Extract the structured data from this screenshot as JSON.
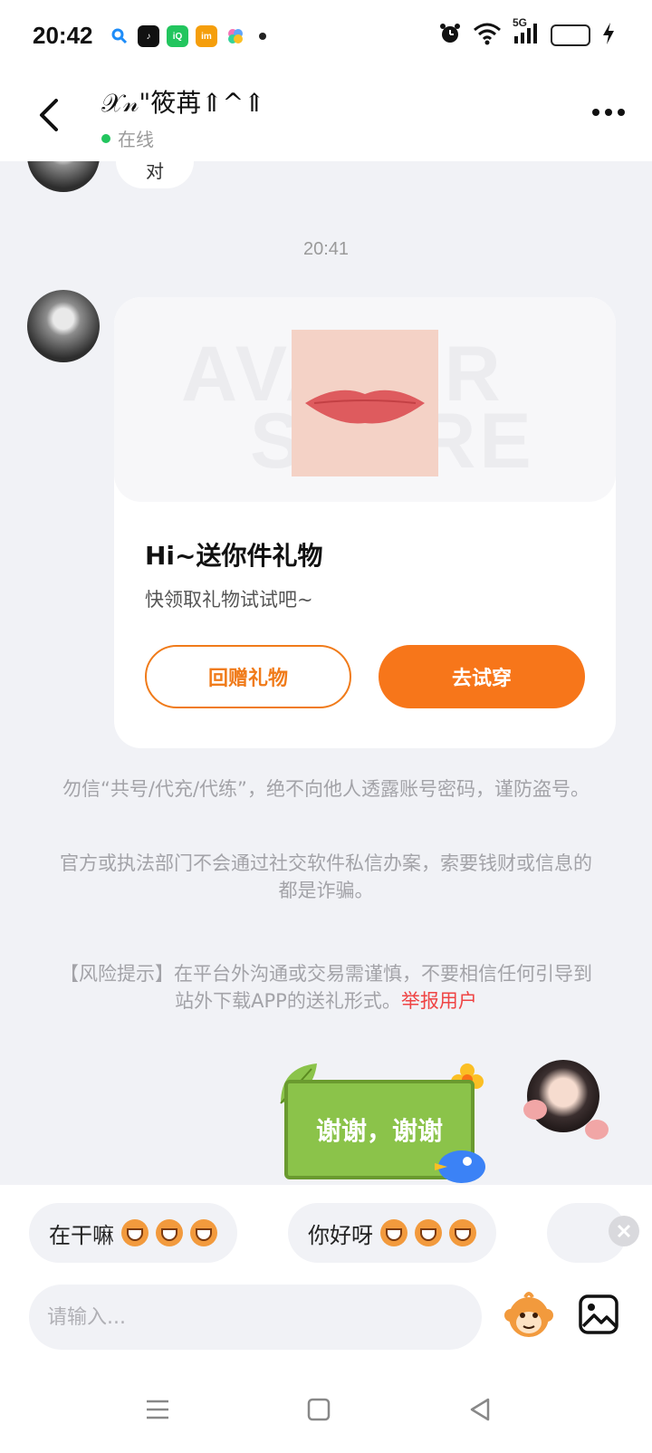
{
  "status_bar": {
    "time": "20:42",
    "app_icons": [
      "search-icon",
      "tiktok-icon",
      "iqiyi-icon",
      "imou-icon",
      "flower-app-icon"
    ],
    "network_label": "5G",
    "battery_level": "5",
    "icons": [
      "alarm-icon",
      "wifi-icon",
      "signal-icon",
      "battery-icon",
      "charging-icon"
    ]
  },
  "header": {
    "contact_name": "𝒳𝓃\"筱苒⇑^⇑",
    "status_text": "在线",
    "status_color": "#22c55e"
  },
  "chat": {
    "partial_message": "对",
    "timestamp": "20:41",
    "gift_card": {
      "watermark_top": "AVATAR",
      "watermark_bottom": "STORE",
      "title": "Hi~送你件礼物",
      "subtitle": "快领取礼物试试吧~",
      "return_gift_label": "回赠礼物",
      "try_on_label": "去试穿",
      "accent_color": "#f7761a"
    },
    "notices": [
      "勿信“共号/代充/代练”，绝不向他人透露账号密码，谨防盗号。",
      "官方或执法部门不会通过社交软件私信办案，索要钱财或信息的都是诈骗。"
    ],
    "risk_notice": {
      "text": "【风险提示】在平台外沟通或交易需谨慎，不要相信任何引导到站外下载APP的送礼形式。",
      "link_label": "举报用户",
      "link_color": "#ef4444"
    },
    "sticker_message": "谢谢，谢谢"
  },
  "quick_replies": [
    {
      "label": "在干嘛",
      "emoji_count": 3
    },
    {
      "label": "你好呀",
      "emoji_count": 3
    }
  ],
  "composer": {
    "placeholder": "请输入..."
  }
}
